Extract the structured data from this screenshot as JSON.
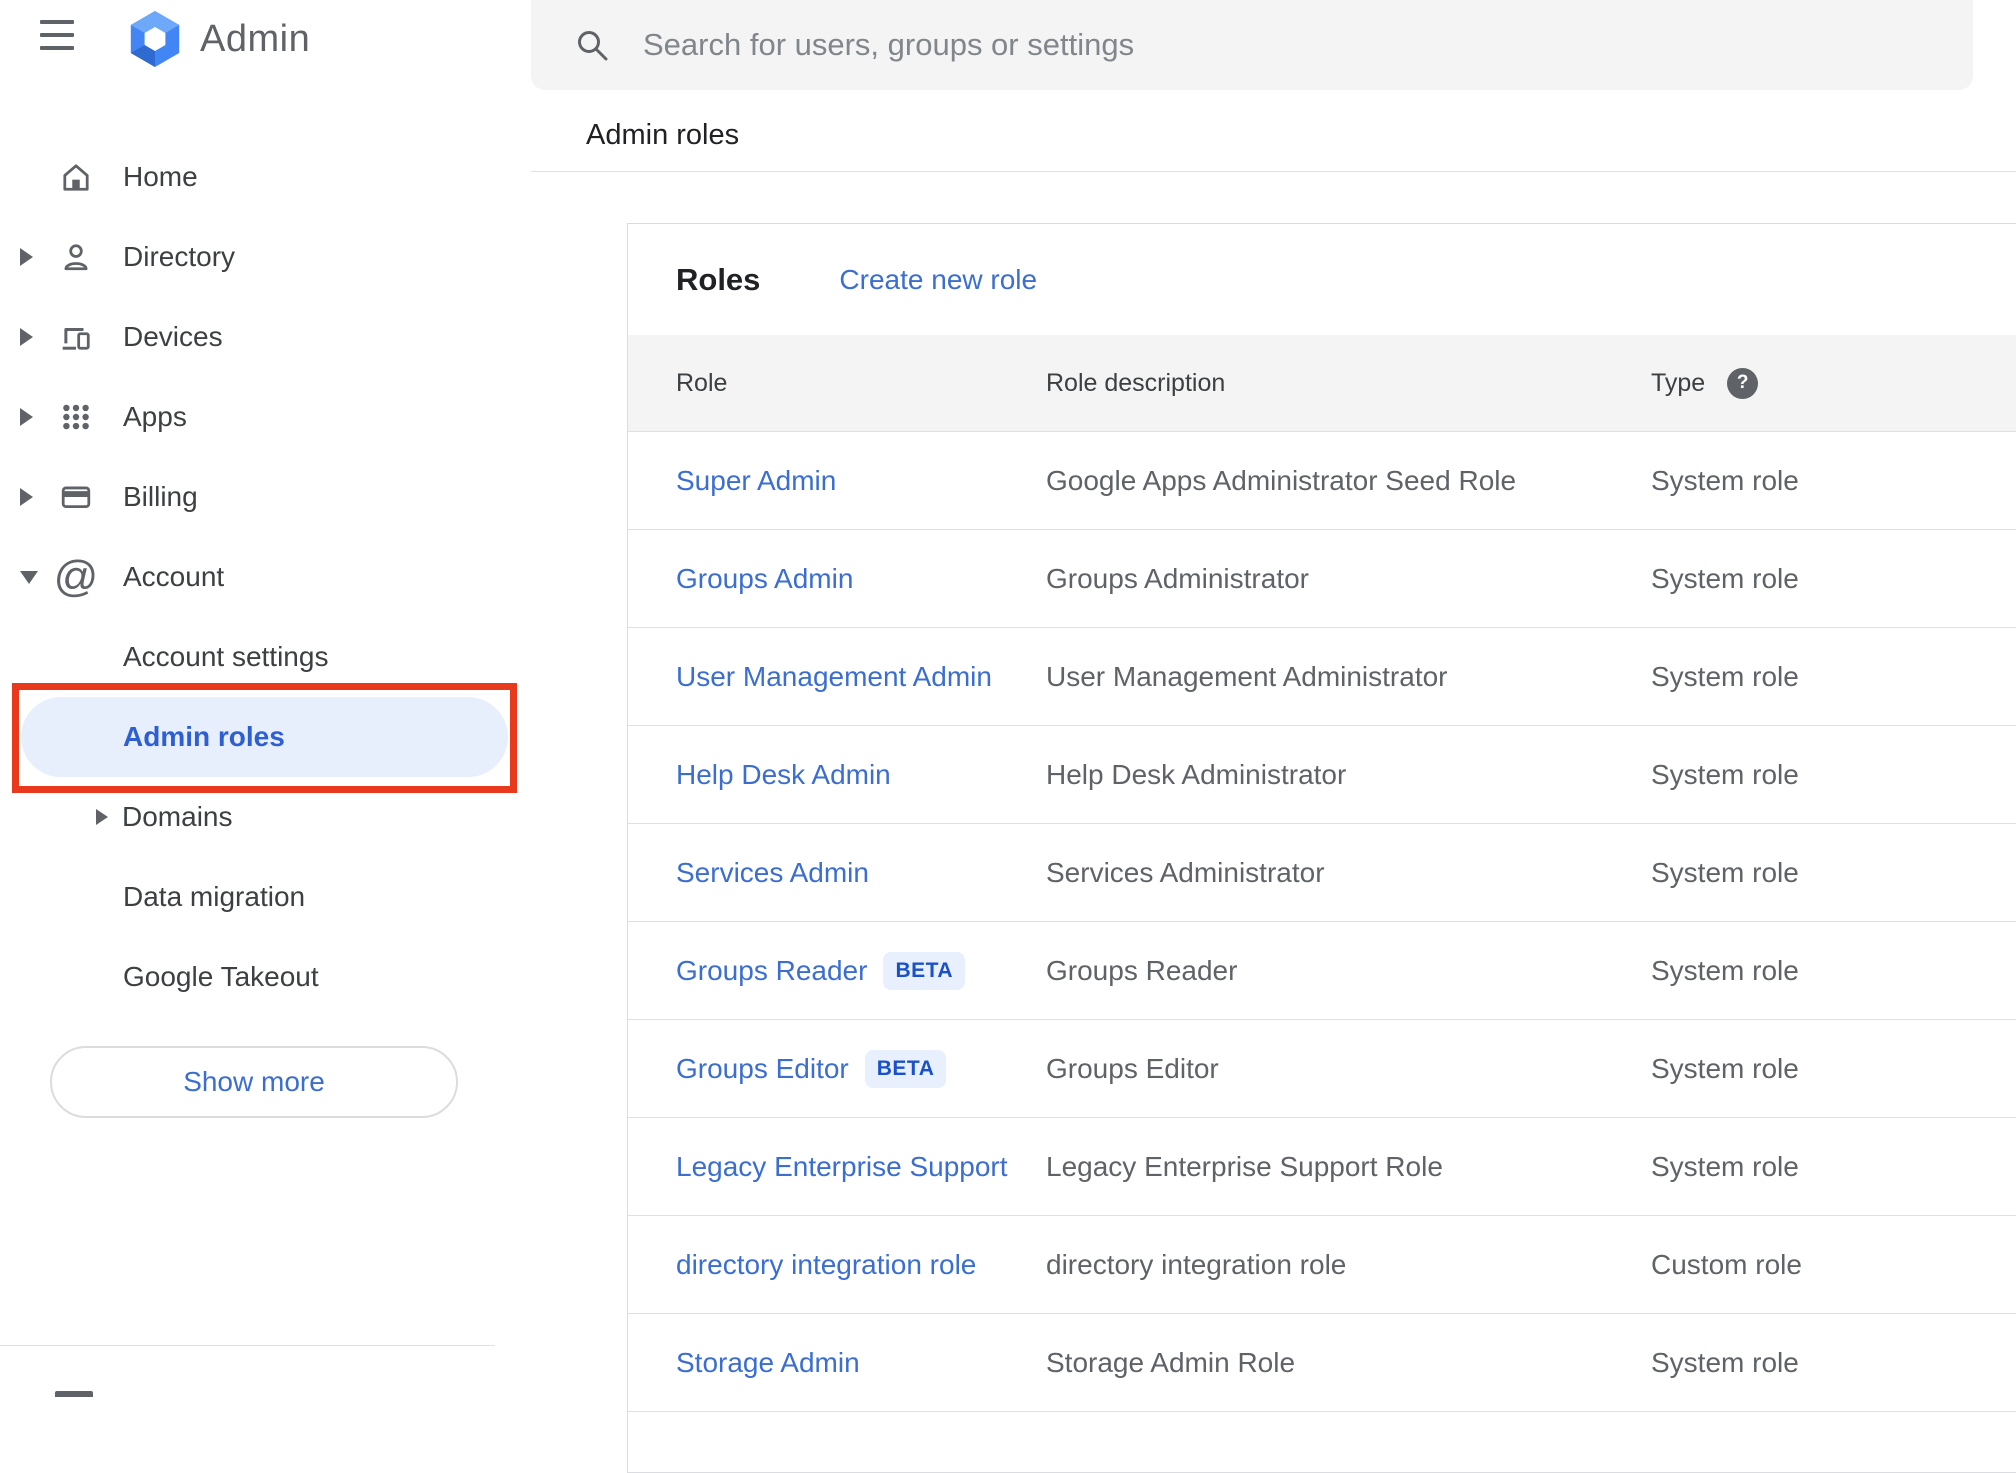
{
  "logo": {
    "product": "Admin"
  },
  "topbar": {
    "search_placeholder": "Search for users, groups or settings"
  },
  "breadcrumb": "Admin roles",
  "sidebar": {
    "items": [
      {
        "label": "Home",
        "icon": "home-icon",
        "expandable": false
      },
      {
        "label": "Directory",
        "icon": "person-icon",
        "expandable": true
      },
      {
        "label": "Devices",
        "icon": "devices-icon",
        "expandable": true
      },
      {
        "label": "Apps",
        "icon": "apps-grid-icon",
        "expandable": true
      },
      {
        "label": "Billing",
        "icon": "credit-card-icon",
        "expandable": true
      },
      {
        "label": "Account",
        "icon": "at-sign-icon",
        "expandable": true,
        "expanded": true
      }
    ],
    "account_children": [
      {
        "label": "Account settings",
        "selected": false
      },
      {
        "label": "Admin roles",
        "selected": true
      },
      {
        "label": "Domains",
        "expandable": true
      },
      {
        "label": "Data migration"
      },
      {
        "label": "Google Takeout"
      }
    ],
    "show_more_label": "Show more"
  },
  "icons": {
    "hamburger": "menu-icon",
    "search": "search-icon",
    "help_glyph": "?",
    "at_sign_glyph": "@"
  },
  "annotation": {
    "shape": "red-rectangle-highlight",
    "target": "Admin roles",
    "color": "#e8391d"
  },
  "roles_panel": {
    "title": "Roles",
    "create_link": "Create new role",
    "beta_label": "BETA",
    "columns": [
      "Role",
      "Role description",
      "Type"
    ],
    "rows": [
      {
        "role": "Super Admin",
        "beta": false,
        "description": "Google Apps Administrator Seed Role",
        "type": "System role"
      },
      {
        "role": "Groups Admin",
        "beta": false,
        "description": "Groups Administrator",
        "type": "System role"
      },
      {
        "role": "User Management Admin",
        "beta": false,
        "description": "User Management Administrator",
        "type": "System role"
      },
      {
        "role": "Help Desk Admin",
        "beta": false,
        "description": "Help Desk Administrator",
        "type": "System role"
      },
      {
        "role": "Services Admin",
        "beta": false,
        "description": "Services Administrator",
        "type": "System role"
      },
      {
        "role": "Groups Reader",
        "beta": true,
        "description": "Groups Reader",
        "type": "System role"
      },
      {
        "role": "Groups Editor",
        "beta": true,
        "description": "Groups Editor",
        "type": "System role"
      },
      {
        "role": "Legacy Enterprise Support",
        "beta": false,
        "description": "Legacy Enterprise Support Role",
        "type": "System role"
      },
      {
        "role": "directory integration role",
        "beta": false,
        "description": "directory integration role",
        "type": "Custom role"
      },
      {
        "role": "Storage Admin",
        "beta": false,
        "description": "Storage Admin Role",
        "type": "System role"
      }
    ]
  },
  "colors": {
    "link_blue": "#3b6ed0",
    "selected_pill_bg": "#e7eefc",
    "selected_pill_text": "#2d5fd3",
    "annotation_red": "#e8391d",
    "beta_badge_bg": "#e8f0fe",
    "beta_badge_text": "#1b51c8",
    "table_header_bg": "#f4f4f4",
    "icon_gray": "#5f6368"
  }
}
